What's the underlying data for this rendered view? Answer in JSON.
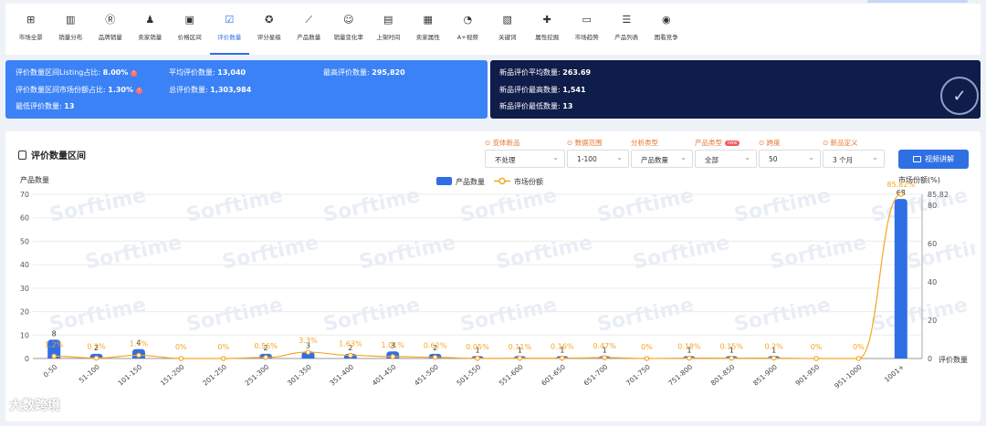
{
  "nav": {
    "active_index": 5,
    "items": [
      {
        "label": "市场全景",
        "icon": "market-overview-icon",
        "glyph": "⊞"
      },
      {
        "label": "销量分布",
        "icon": "bar-chart-icon",
        "glyph": "▥"
      },
      {
        "label": "品牌销量",
        "icon": "brand-icon",
        "glyph": "Ⓡ"
      },
      {
        "label": "卖家销量",
        "icon": "seller-icon",
        "glyph": "♟"
      },
      {
        "label": "价格区间",
        "icon": "price-range-icon",
        "glyph": "▣"
      },
      {
        "label": "评价数量",
        "icon": "review-count-icon",
        "glyph": "☑"
      },
      {
        "label": "评分星级",
        "icon": "star-rating-icon",
        "glyph": "✪"
      },
      {
        "label": "产品数量",
        "icon": "trend-line-icon",
        "glyph": "⟋"
      },
      {
        "label": "销量变化率",
        "icon": "smile-icon",
        "glyph": "☺"
      },
      {
        "label": "上架时间",
        "icon": "calendar-icon",
        "glyph": "▤"
      },
      {
        "label": "卖家属性",
        "icon": "store-icon",
        "glyph": "▦"
      },
      {
        "label": "A+视频",
        "icon": "pie-icon",
        "glyph": "◔"
      },
      {
        "label": "关键词",
        "icon": "keyword-icon",
        "glyph": "▧"
      },
      {
        "label": "属性挖掘",
        "icon": "puzzle-icon",
        "glyph": "✚"
      },
      {
        "label": "市场趋势",
        "icon": "tv-icon",
        "glyph": "▭"
      },
      {
        "label": "产品列表",
        "icon": "list-icon",
        "glyph": "☰"
      },
      {
        "label": "图看竞争",
        "icon": "globe-icon",
        "glyph": "◉"
      }
    ]
  },
  "stats_blue": {
    "listing_ratio_label": "评价数量区间Listing占比:",
    "listing_ratio_value": "8.00%",
    "share_ratio_label": "评价数量区间市场份额占比:",
    "share_ratio_value": "1.30%",
    "min_label": "最低评价数量:",
    "min_value": "13",
    "avg_label": "平均评价数量:",
    "avg_value": "13,040",
    "total_label": "总评价数量:",
    "total_value": "1,303,984",
    "max_label": "最高评价数量:",
    "max_value": "295,820"
  },
  "stats_dark": {
    "new_avg_label": "新品评价平均数量:",
    "new_avg_value": "263.69",
    "new_max_label": "新品评价最高数量:",
    "new_max_value": "1,541",
    "new_min_label": "新品评价最低数量:",
    "new_min_value": "13",
    "logo_text": "Sorftime"
  },
  "panel": {
    "title": "评价数量区间",
    "video_button": "视频讲解"
  },
  "filters": [
    {
      "label": "变体新品",
      "value": "不处理",
      "label_color": "orange",
      "has_icon": true
    },
    {
      "label": "数据范围",
      "value": "1-100",
      "label_color": "orange",
      "has_icon": true
    },
    {
      "label": "分析类型",
      "value": "产品数量",
      "label_color": "orange",
      "has_icon": false
    },
    {
      "label": "产品类型",
      "value": "全部",
      "label_color": "orange",
      "has_icon": false,
      "tag": "new"
    },
    {
      "label": "跨度",
      "value": "50",
      "label_color": "orange",
      "has_icon": true
    },
    {
      "label": "新品定义",
      "value": "3 个月",
      "label_color": "orange",
      "has_icon": true
    }
  ],
  "watermark": "大数跨境",
  "chart_data": {
    "type": "bar",
    "categories": [
      "0-50",
      "51-100",
      "101-150",
      "151-200",
      "201-250",
      "251-300",
      "301-350",
      "351-400",
      "401-450",
      "451-500",
      "501-550",
      "551-600",
      "601-650",
      "651-700",
      "701-750",
      "751-800",
      "801-850",
      "851-900",
      "901-950",
      "951-1000",
      "1001+"
    ],
    "series": [
      {
        "name": "产品数量",
        "type": "bar",
        "axis": "left",
        "color": "#2f6fe4",
        "values": [
          8,
          2,
          4,
          0,
          0,
          2,
          3,
          2,
          3,
          2,
          1,
          1,
          1,
          1,
          0,
          1,
          1,
          1,
          0,
          0,
          68
        ]
      },
      {
        "name": "市场份额",
        "type": "line",
        "axis": "right",
        "color": "#f5a623",
        "values": [
          1.2,
          0.2,
          1.7,
          0,
          0,
          0.56,
          3.3,
          1.63,
          1.01,
          0.62,
          0.05,
          0.11,
          0.16,
          0.47,
          0,
          0.18,
          0.15,
          0.2,
          0,
          0,
          85.82
        ],
        "labels": [
          "1.2%",
          "0.2%",
          "1.7%",
          "0%",
          "0%",
          "0.56%",
          "3.3%",
          "1.63%",
          "1.01%",
          "0.62%",
          "0.05%",
          "0.11%",
          "0.16%",
          "0.47%",
          "0%",
          "0.18%",
          "0.15%",
          "0.2%",
          "0%",
          "0%",
          "85.82%"
        ]
      }
    ],
    "ylabel": "产品数量",
    "ylabel_right": "市场份额(%)",
    "xlabel_right": "评价数量",
    "ylim": [
      0,
      70
    ],
    "yticks": [
      0,
      10,
      20,
      30,
      40,
      50,
      60,
      70
    ],
    "ylim_right": [
      0,
      85.82
    ],
    "yticks_right": [
      0,
      20,
      40,
      60,
      80,
      85.82
    ],
    "grid": true,
    "legend": "top-center",
    "watermark": "Sorftime"
  }
}
